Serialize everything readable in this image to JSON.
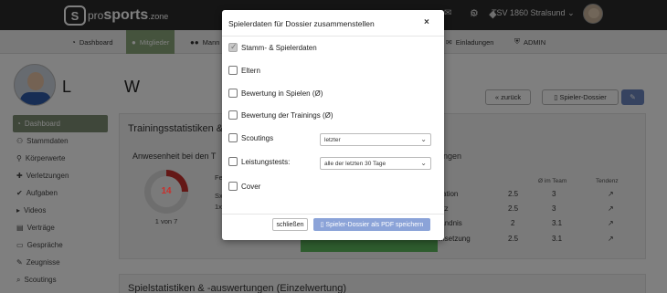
{
  "header": {
    "logo_mark": "S",
    "logo_pro": "pro",
    "logo_sports": "sports",
    "logo_zone": ".zone",
    "club": "TSV 1860 Stralsund",
    "icons": [
      "search-icon",
      "bell-icon",
      "envelope-icon",
      "gear-icon"
    ]
  },
  "nav": {
    "items": [
      {
        "label": "Dashboard",
        "icon": "gauge-icon"
      },
      {
        "label": "Mitglieder",
        "icon": "user-icon"
      },
      {
        "label": "Mann",
        "icon": "users-icon"
      },
      {
        "label": "Einladungen",
        "icon": "envelope-icon"
      },
      {
        "label": "ADMIN",
        "icon": "shield-icon"
      }
    ]
  },
  "profile": {
    "first": "L",
    "last": "W"
  },
  "sidebar": {
    "items": [
      {
        "label": "Dashboard"
      },
      {
        "label": "Stammdaten"
      },
      {
        "label": "Körperwerte"
      },
      {
        "label": "Verletzungen"
      },
      {
        "label": "Aufgaben"
      },
      {
        "label": "Videos"
      },
      {
        "label": "Verträge"
      },
      {
        "label": "Gespräche"
      },
      {
        "label": "Zeugnisse"
      },
      {
        "label": "Scoutings"
      }
    ]
  },
  "buttons": {
    "back": "« zurück",
    "dossier": "Spieler-Dossier"
  },
  "content": {
    "panel_title": "Trainingsstatistiken &",
    "attendance": "Anwesenheit bei den T",
    "ring_value": "14",
    "ring_sub": "1 von 7",
    "col_fragment": "Fe",
    "row_frag_1": "Sx",
    "row_frag_2": "1x",
    "right_title": "ungen",
    "table_head": [
      "Ø im Team",
      "Tendenz"
    ],
    "rows": [
      {
        "label": "vation",
        "val": "2.5",
        "team": "3",
        "trend": "↗"
      },
      {
        "label": "atz",
        "val": "2.5",
        "team": "3",
        "trend": "↗"
      },
      {
        "label": "tändnis",
        "val": "2",
        "team": "3.1",
        "trend": "↗"
      },
      {
        "label": "msetzung",
        "val": "2.5",
        "team": "3.1",
        "trend": "↗"
      }
    ],
    "panel2_title": "Spielstatistiken & -auswertungen (Einzelwertung)"
  },
  "modal": {
    "title": "Spielerdaten für Dossier zusammenstellen",
    "close": "×",
    "options": [
      {
        "label": "Stamm- & Spielerdaten",
        "checked": true
      },
      {
        "label": "Eltern",
        "checked": false
      },
      {
        "label": "Bewertung in Spielen (Ø)",
        "checked": false
      },
      {
        "label": "Bewertung der Trainings (Ø)",
        "checked": false
      },
      {
        "label": "Scoutings",
        "checked": false
      },
      {
        "label": "Leistungstests:",
        "checked": false
      },
      {
        "label": "Cover",
        "checked": false
      }
    ],
    "scouting_select": "letzter",
    "tests_select": "alle der letzten 30 Tage",
    "close_button": "schließen",
    "save_button": "Spieler-Dossier als PDF speichern"
  },
  "colors": {
    "accent_green": "#8aa67a",
    "primary_blue": "#6c86c0",
    "ring_red": "#c9302c",
    "bar_green": "#5cb85c"
  }
}
